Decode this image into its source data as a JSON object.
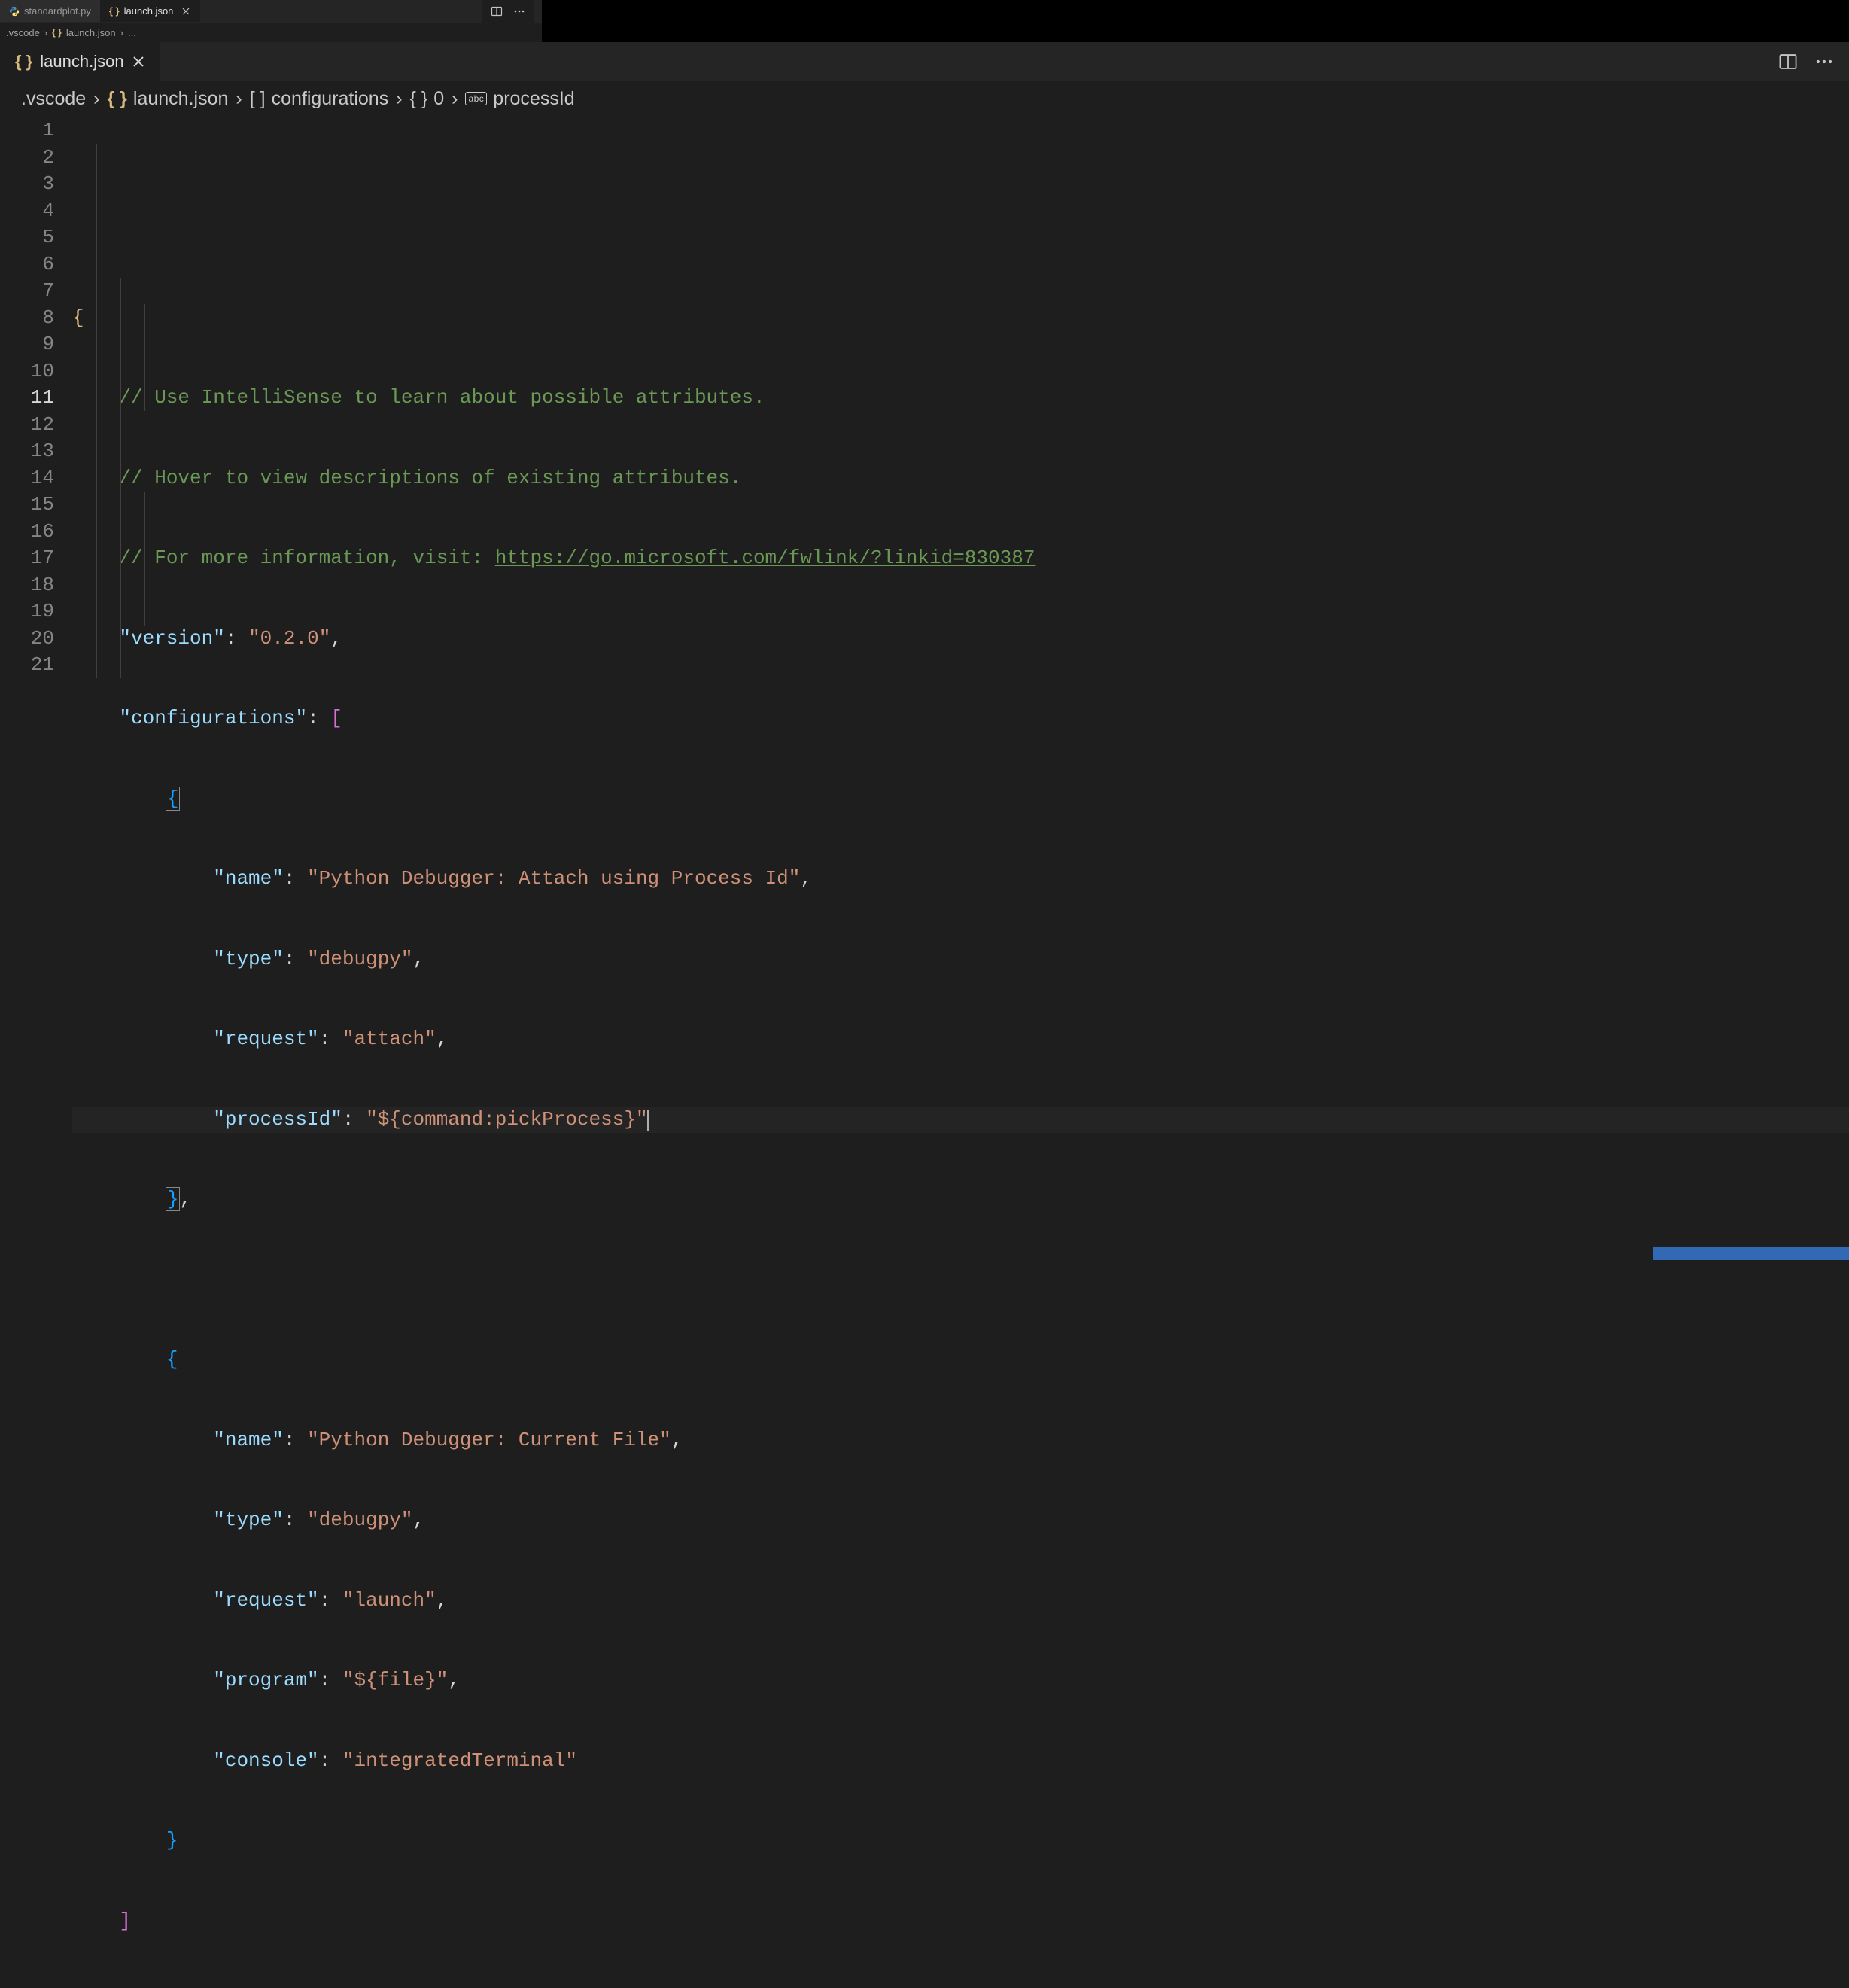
{
  "outer": {
    "tabs": [
      {
        "label": "standardplot.py",
        "icon": "python-icon",
        "active": false
      },
      {
        "label": "launch.json",
        "icon": "json-icon",
        "active": true
      }
    ],
    "breadcrumb": [
      {
        "label": ".vscode"
      },
      {
        "label": "launch.json",
        "icon": "json-icon"
      },
      {
        "label": "..."
      }
    ]
  },
  "inner": {
    "tab": {
      "label": "launch.json",
      "icon": "json-icon"
    },
    "breadcrumb": [
      {
        "label": ".vscode"
      },
      {
        "label": "launch.json",
        "icon": "json-icon"
      },
      {
        "label": "configurations",
        "icon": "array-icon"
      },
      {
        "label": "0",
        "icon": "object-icon"
      },
      {
        "label": "processId",
        "icon": "string-icon"
      }
    ]
  },
  "code": {
    "comment1": "// Use IntelliSense to learn about possible attributes.",
    "comment2": "// Hover to view descriptions of existing attributes.",
    "comment3_prefix": "// For more information, visit: ",
    "comment3_link": "https://go.microsoft.com/fwlink/?linkid=830387",
    "k_version": "\"version\"",
    "v_version": "\"0.2.0\"",
    "k_configurations": "\"configurations\"",
    "k_name": "\"name\"",
    "k_type": "\"type\"",
    "k_request": "\"request\"",
    "k_processId": "\"processId\"",
    "k_program": "\"program\"",
    "k_console": "\"console\"",
    "v_cfg0_name": "\"Python Debugger: Attach using Process Id\"",
    "v_cfg0_type": "\"debugpy\"",
    "v_cfg0_request": "\"attach\"",
    "v_cfg0_processId": "\"${command:pickProcess}\"",
    "v_cfg1_name": "\"Python Debugger: Current File\"",
    "v_cfg1_type": "\"debugpy\"",
    "v_cfg1_request": "\"launch\"",
    "v_cfg1_program": "\"${file}\"",
    "v_cfg1_console": "\"integratedTerminal\"",
    "line_numbers": [
      "1",
      "2",
      "3",
      "4",
      "5",
      "6",
      "7",
      "8",
      "9",
      "10",
      "11",
      "12",
      "13",
      "14",
      "15",
      "16",
      "17",
      "18",
      "19",
      "20",
      "21"
    ]
  }
}
